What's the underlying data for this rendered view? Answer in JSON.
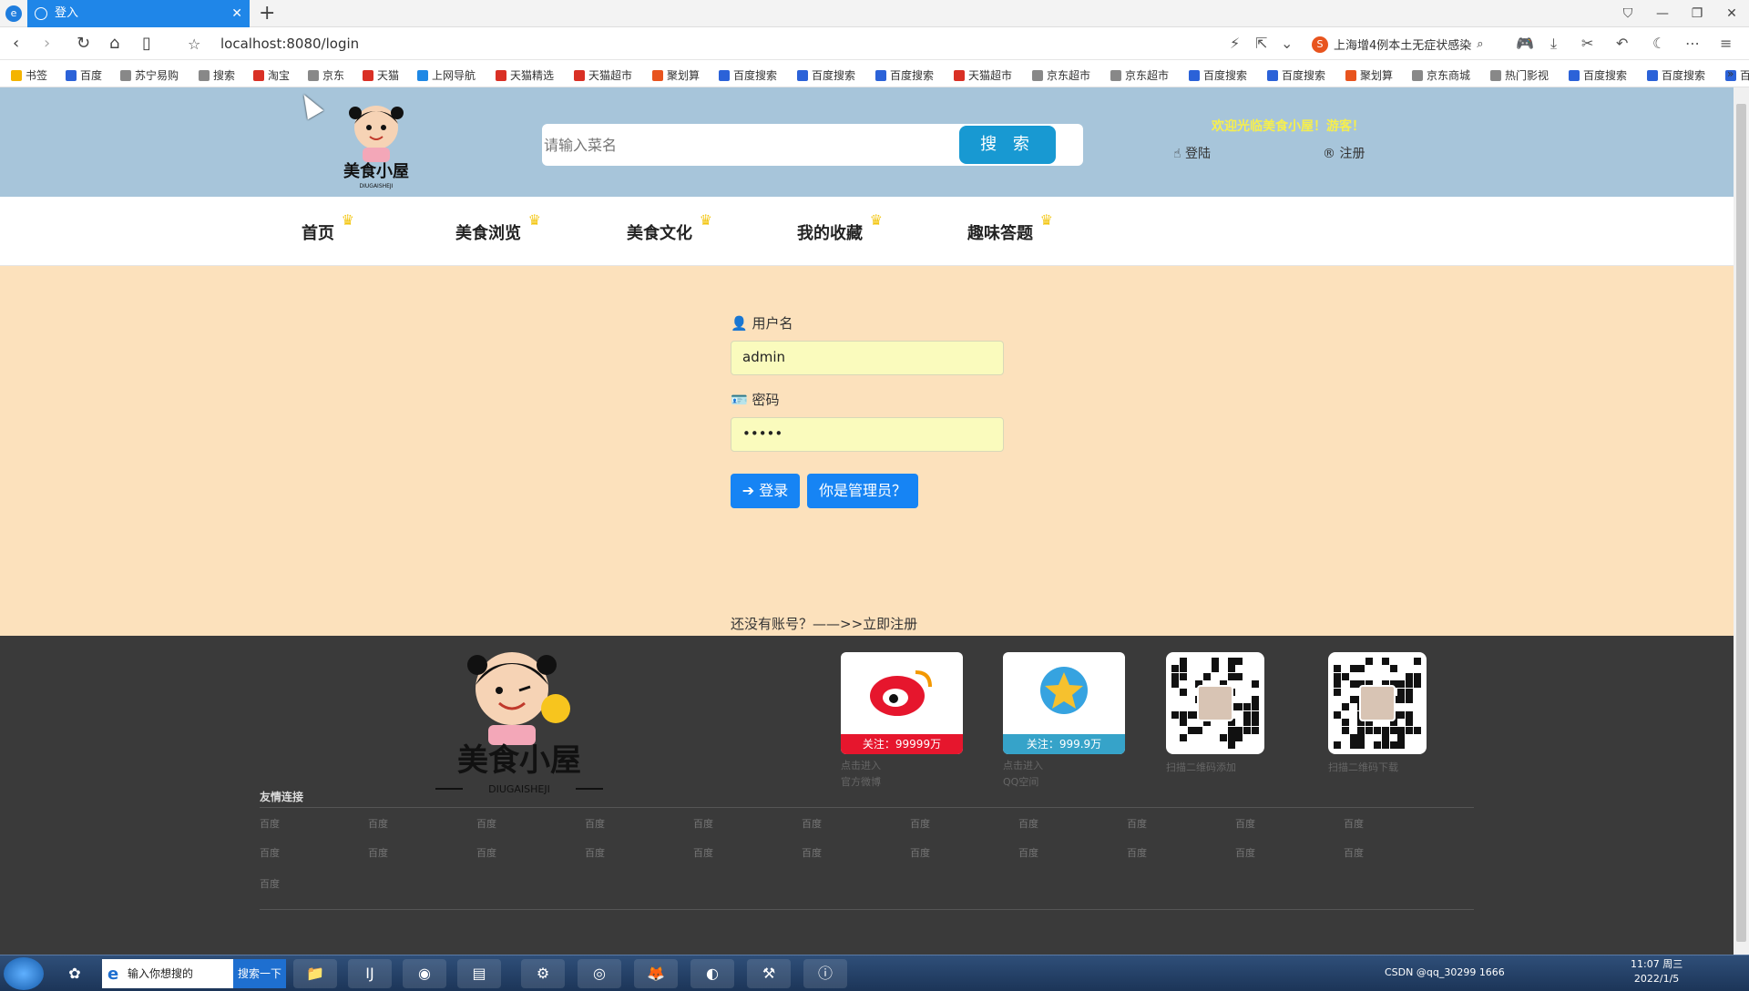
{
  "browser": {
    "tab_title": "登入",
    "url": "localhost:8080/login",
    "news_text": "上海增4例本土无症状感染",
    "bookmarks": [
      "书签",
      "百度",
      "苏宁易购",
      "搜索",
      "淘宝",
      "京东",
      "天猫",
      "上网导航",
      "天猫精选",
      "天猫超市",
      "聚划算",
      "百度搜索",
      "百度搜索",
      "百度搜索",
      "天猫超市",
      "京东超市",
      "京东超市",
      "百度搜索",
      "百度搜索",
      "聚划算",
      "京东商城",
      "热门影视",
      "百度搜索",
      "百度搜索",
      "百度搜索"
    ]
  },
  "header": {
    "search_placeholder": "请输入菜名",
    "search_button": "搜 索",
    "welcome": "欢迎光临美食小屋！游客！",
    "login": "登陆",
    "register": "注册"
  },
  "menu": [
    "首页",
    "美食浏览",
    "美食文化",
    "我的收藏",
    "趣味答题"
  ],
  "form": {
    "username_label": "用户名",
    "username_value": "admin",
    "password_label": "密码",
    "password_value": "•••••",
    "login_button": "登录",
    "admin_button": "你是管理员？",
    "register_line": "还没有账号？——>>立即注册"
  },
  "footer": {
    "weibo_follow": "关注：99999万",
    "weibo_text1": "点击进入",
    "weibo_text2": "官方微博",
    "qq_follow": "关注：999.9万",
    "qq_text1": "点击进入",
    "qq_text2": "QQ空间",
    "qr1_text": "扫描二维码添加",
    "qr2_text": "扫描二维码下载",
    "links_title": "友情连接",
    "link_text": "百度"
  },
  "taskbar": {
    "search_text": "输入你想搜的",
    "search_btn": "搜索一下",
    "tray": "CSDN @qq_30299 1666",
    "time": "11:07 周三",
    "date": "2022/1/5"
  }
}
